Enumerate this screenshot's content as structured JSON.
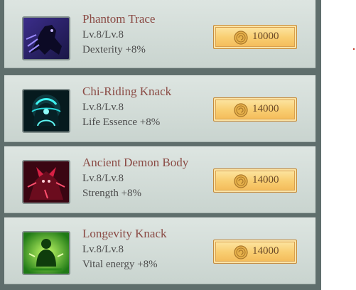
{
  "skills": [
    {
      "name": "Phantom Trace",
      "level": "Lv.8/Lv.8",
      "bonus": "Dexterity +8%",
      "price": "10000",
      "icon": "phantom-trace-icon"
    },
    {
      "name": "Chi-Riding Knack",
      "level": "Lv.8/Lv.8",
      "bonus": "Life Essence +8%",
      "price": "14000",
      "icon": "chi-riding-knack-icon"
    },
    {
      "name": "Ancient Demon Body",
      "level": "Lv.8/Lv.8",
      "bonus": "Strength +8%",
      "price": "14000",
      "icon": "ancient-demon-body-icon"
    },
    {
      "name": "Longevity Knack",
      "level": "Lv.8/Lv.8",
      "bonus": "Vital energy +8%",
      "price": "14000",
      "icon": "longevity-knack-icon"
    }
  ],
  "colors": {
    "panel": "#5f6e6c",
    "name_text": "#8a4a44",
    "button_gold": "#f9cf73"
  }
}
